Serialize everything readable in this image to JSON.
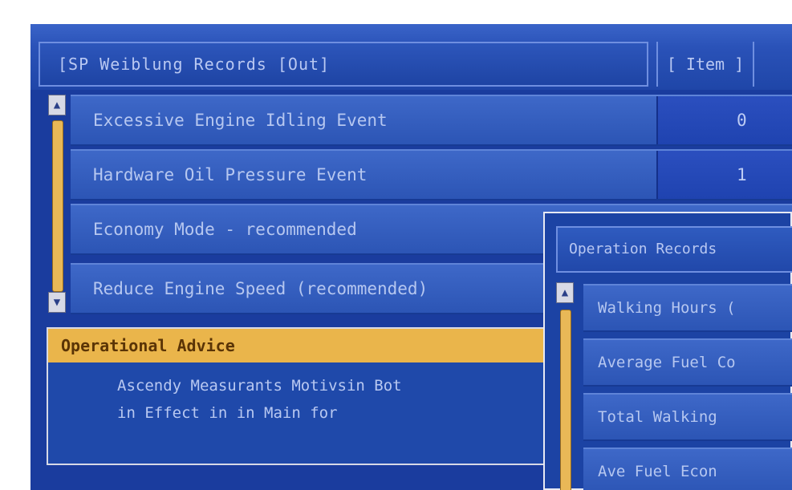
{
  "header": {
    "title": "[SP Weiblung Records [Out]",
    "tab": "[ Item ]"
  },
  "rows": [
    {
      "label": "Excessive Engine Idling Event",
      "value": "0"
    },
    {
      "label": "Hardware Oil Pressure Event",
      "value": "1"
    },
    {
      "label": "Economy Mode - recommended",
      "value": ""
    },
    {
      "label": "Reduce Engine Speed (recommended)",
      "value": ""
    }
  ],
  "advice": {
    "heading": "Operational Advice",
    "line1": "Ascendy Measurants Motivsin Bot",
    "line2": "in Effect in in Main for"
  },
  "popup": {
    "title": "Operation Records",
    "rows": [
      "Walking Hours (",
      "Average Fuel Co",
      "Total Walking",
      "Ave Fuel Econ"
    ]
  },
  "icons": {
    "scroll_up": "up-arrow-icon",
    "scroll_down": "down-arrow-icon"
  }
}
